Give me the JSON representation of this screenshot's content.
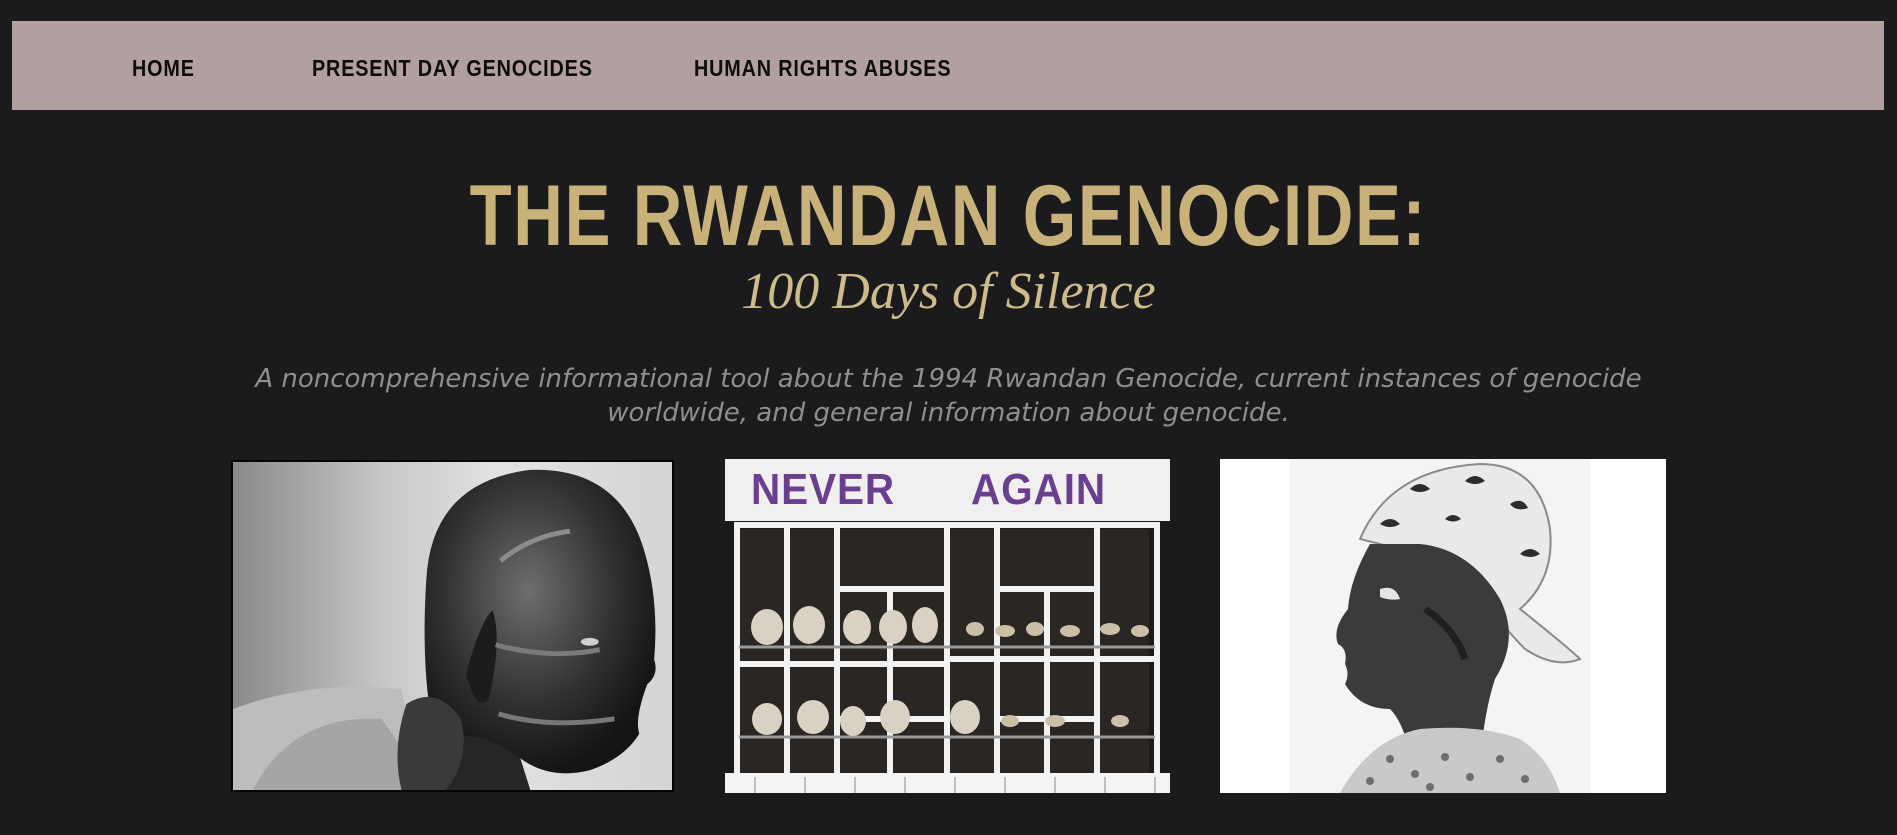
{
  "nav": {
    "items": [
      {
        "label": "HOME"
      },
      {
        "label": "PRESENT DAY GENOCIDES"
      },
      {
        "label": "HUMAN RIGHTS ABUSES"
      }
    ]
  },
  "hero": {
    "title": "THE RWANDAN GENOCIDE:",
    "subtitle": "100 Days of Silence",
    "description": "A noncomprehensive informational tool about the 1994 Rwandan Genocide, current instances of genocide worldwide, and general information about genocide."
  },
  "gallery": {
    "memorial_sign": {
      "word1": "NEVER",
      "word2": "AGAIN"
    }
  },
  "colors": {
    "background": "#1b1b1d",
    "nav_bar": "#b29f9f",
    "title_gold": "#c9b27a",
    "description_grey": "#8f8f8f"
  }
}
